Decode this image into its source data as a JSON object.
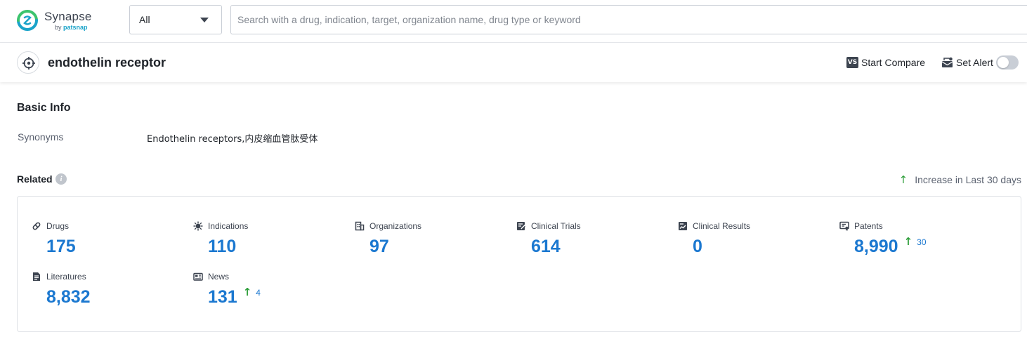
{
  "brand": {
    "name": "Synapse",
    "by_prefix": "by",
    "by_name": "patsnap",
    "logo_icon": "synapse-logo-icon"
  },
  "search": {
    "type_selected": "All",
    "placeholder": "Search with a drug, indication, target, organization name, drug type or keyword"
  },
  "header": {
    "title": "endothelin receptor",
    "target_icon": "crosshair-icon",
    "compare_label": "Start Compare",
    "compare_icon_text": "VS",
    "alert_label": "Set Alert",
    "alert_enabled": false
  },
  "basic_info": {
    "heading": "Basic Info",
    "synonyms_label": "Synonyms",
    "synonyms_value": "Endothelin receptors,内皮缩血管肽受体"
  },
  "related": {
    "heading": "Related",
    "info_glyph": "i",
    "legend_arrow": "↑",
    "legend_label": "Increase in Last 30 days",
    "stats": [
      {
        "label": "Drugs",
        "value": "175",
        "icon": "pill-icon"
      },
      {
        "label": "Indications",
        "value": "110",
        "icon": "virus-icon"
      },
      {
        "label": "Organizations",
        "value": "97",
        "icon": "building-icon"
      },
      {
        "label": "Clinical Trials",
        "value": "614",
        "icon": "clinical-trial-icon"
      },
      {
        "label": "Clinical Results",
        "value": "0",
        "icon": "clinical-result-icon"
      },
      {
        "label": "Patents",
        "value": "8,990",
        "icon": "patent-icon",
        "increase_arrow": "↑",
        "increase": "30"
      },
      {
        "label": "Literatures",
        "value": "8,832",
        "icon": "document-icon"
      },
      {
        "label": "News",
        "value": "131",
        "icon": "news-icon",
        "increase_arrow": "↑",
        "increase": "4"
      }
    ]
  },
  "colors": {
    "accent_blue": "#1b78d0",
    "increase_green": "#2e9e3a",
    "logo_teal": "#1aa3c9",
    "logo_green": "#3cc46e"
  }
}
